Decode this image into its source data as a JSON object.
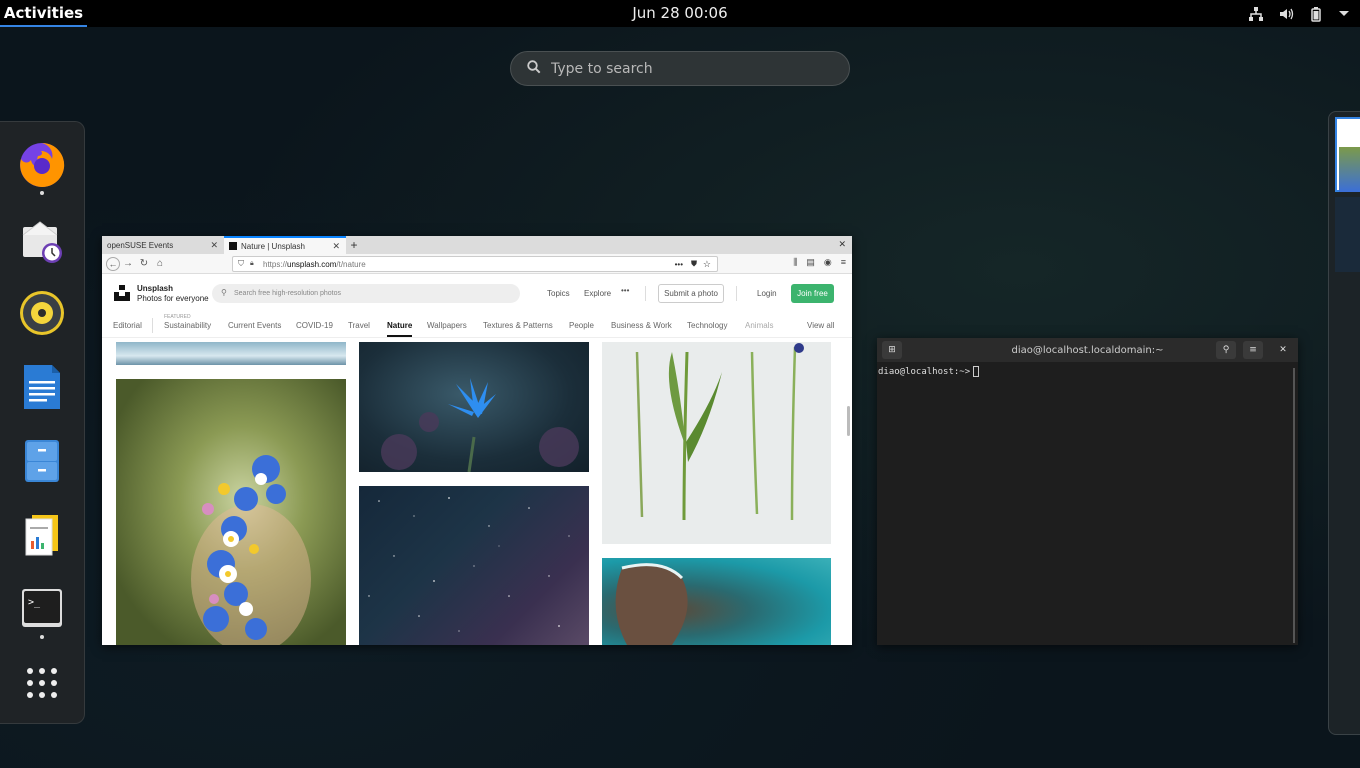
{
  "topbar": {
    "activities": "Activities",
    "clock": "Jun 28  00:06"
  },
  "search": {
    "placeholder": "Type to search"
  },
  "dash": {
    "apps": [
      {
        "name": "Firefox",
        "icon": "firefox-icon",
        "running": true
      },
      {
        "name": "Evolution",
        "icon": "mail-clock-icon",
        "running": false
      },
      {
        "name": "Rhythmbox",
        "icon": "speaker-icon",
        "running": false
      },
      {
        "name": "LibreOffice Writer",
        "icon": "document-icon",
        "running": false
      },
      {
        "name": "Files",
        "icon": "file-cabinet-icon",
        "running": false
      },
      {
        "name": "LibreOffice",
        "icon": "office-suite-icon",
        "running": false
      },
      {
        "name": "Terminal",
        "icon": "terminal-icon",
        "running": true
      },
      {
        "name": "Show Applications",
        "icon": "app-grid-icon",
        "running": false
      }
    ]
  },
  "browser": {
    "tabs": [
      {
        "label": "openSUSE Events"
      },
      {
        "label": "Nature | Unsplash"
      }
    ],
    "url_prefix": "https://",
    "url_host": "unsplash.com",
    "url_path": "/t/nature",
    "site": {
      "brand": "Unsplash",
      "tagline": "Photos for everyone",
      "search_placeholder": "Search free high-resolution photos",
      "links": {
        "topics": "Topics",
        "explore": "Explore",
        "more": "•••"
      },
      "submit": "Submit a photo",
      "login": "Login",
      "join": "Join free",
      "featured": "FEATURED",
      "categories": [
        "Editorial",
        "Sustainability",
        "Current Events",
        "COVID-19",
        "Travel",
        "Nature",
        "Wallpapers",
        "Textures & Patterns",
        "People",
        "Business & Work",
        "Technology",
        "Animals"
      ],
      "view_all": "View all"
    }
  },
  "terminal": {
    "title": "diao@localhost.localdomain:~",
    "prompt": "diao@localhost:~>"
  },
  "colors": {
    "accent": "#3584e4",
    "join_green": "#3cb46e"
  }
}
